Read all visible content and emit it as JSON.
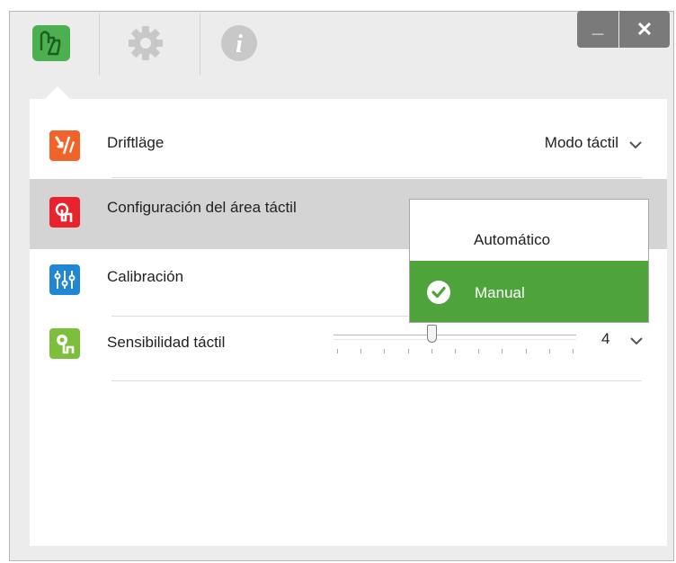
{
  "tabs": [
    {
      "icon": "touch-hand-icon",
      "active": true,
      "color": "#4caf50"
    },
    {
      "icon": "gear-icon",
      "active": false
    },
    {
      "icon": "info-icon",
      "active": false
    }
  ],
  "window_buttons": {
    "minimize": "_",
    "close": "✕"
  },
  "rows": {
    "mode": {
      "label": "Driftläge",
      "value": "Modo táctil",
      "icon_color": "#f0642a"
    },
    "area": {
      "label": "Configuración del área táctil",
      "icon_color": "#e8232e"
    },
    "calibration": {
      "label": "Calibración",
      "icon_color": "#1e88d6"
    },
    "sensitivity": {
      "label": "Sensibilidad táctil",
      "value": "4",
      "slider_level": 4,
      "slider_max": 10,
      "icon_color": "#7cbf3a"
    }
  },
  "dropdown": {
    "options": [
      {
        "label": "Automático",
        "selected": false
      },
      {
        "label": "Manual",
        "selected": true
      }
    ],
    "selected_color": "#4ea43b"
  }
}
